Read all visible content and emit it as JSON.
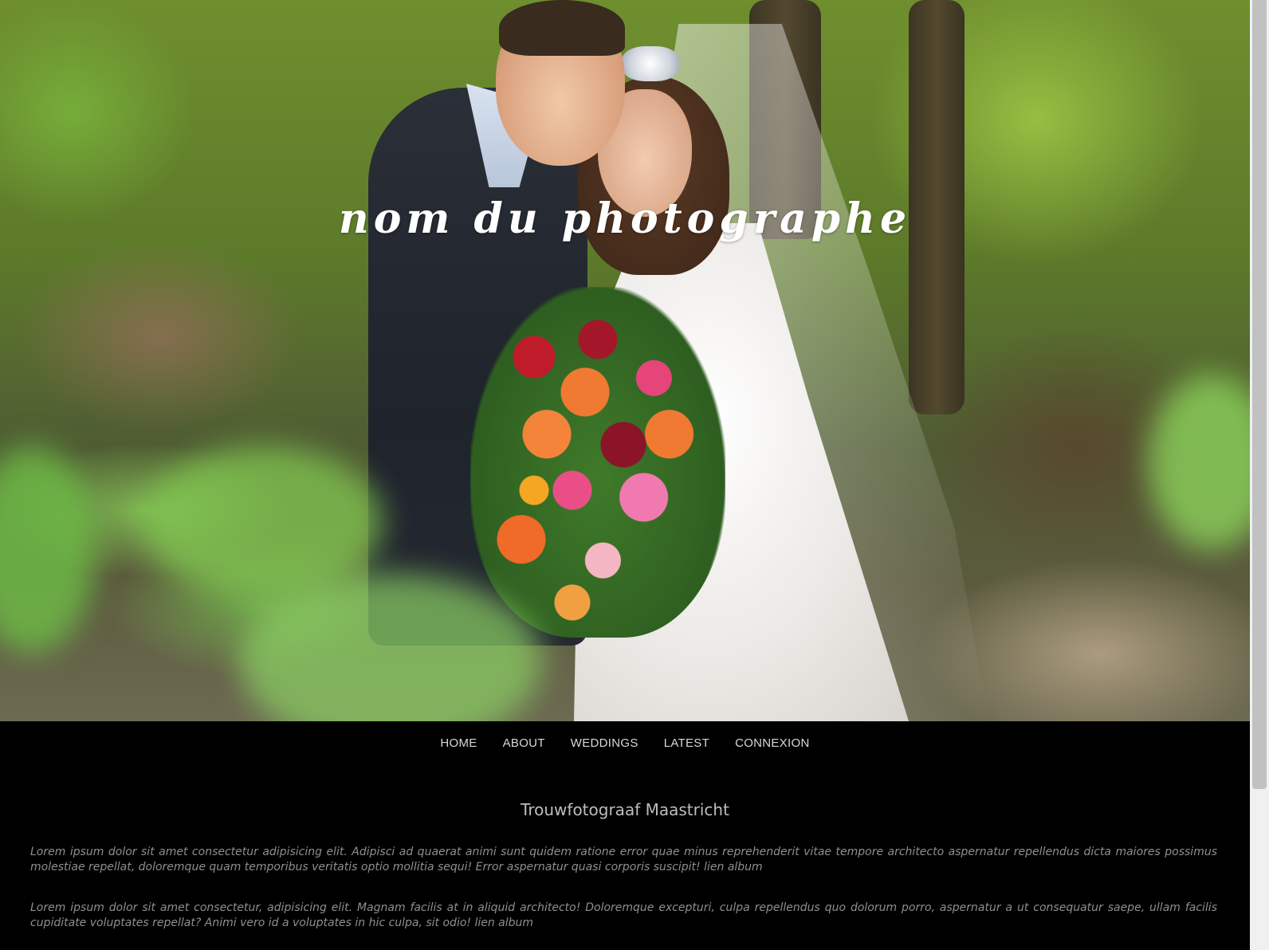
{
  "hero": {
    "title": "nom du photographe"
  },
  "nav": {
    "items": [
      {
        "label": "HOME"
      },
      {
        "label": "ABOUT"
      },
      {
        "label": "WEDDINGS"
      },
      {
        "label": "LATEST"
      },
      {
        "label": "CONNEXION"
      }
    ]
  },
  "content": {
    "heading": "Trouwfotograaf Maastricht",
    "paragraphs": [
      "Lorem ipsum dolor sit amet consectetur adipisicing elit. Adipisci ad quaerat animi sunt quidem ratione error quae minus reprehenderit vitae tempore architecto aspernatur repellendus dicta maiores possimus molestiae repellat, doloremque quam temporibus veritatis optio mollitia sequi! Error aspernatur quasi corporis suscipit! lien album",
      "Lorem ipsum dolor sit amet consectetur, adipisicing elit. Magnam facilis at in aliquid architecto! Doloremque excepturi, culpa repellendus quo dolorum porro, aspernatur a ut consequatur saepe, ullam facilis cupiditate voluptates repellat? Animi vero id a voluptates in hic culpa, sit odio! lien album"
    ]
  },
  "colors": {
    "background": "#000000",
    "nav_text": "#d8d8d8",
    "heading_text": "#bdbdbd",
    "body_text": "#8f8f8f"
  }
}
